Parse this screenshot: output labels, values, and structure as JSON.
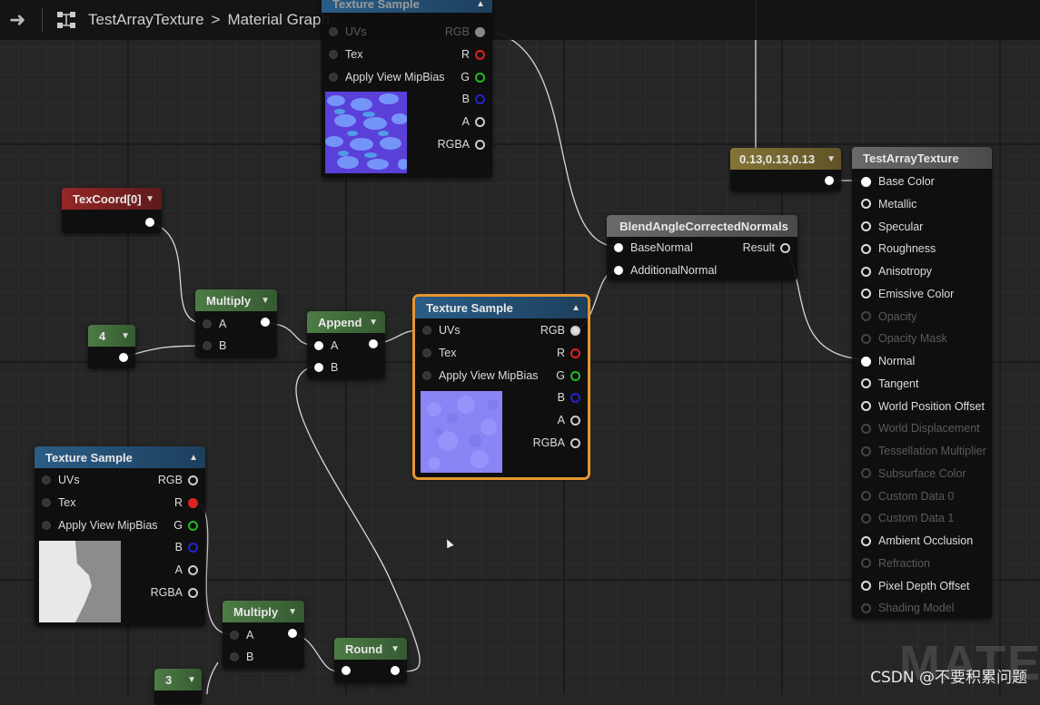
{
  "topbar": {
    "asset_name": "TestArrayTexture",
    "separator": ">",
    "graph_name": "Material Graph"
  },
  "nodes": {
    "tex_sample_top": {
      "title": "Texture Sample",
      "inputs": [
        "UVs",
        "Tex",
        "Apply View MipBias"
      ],
      "outputs": [
        "RGB",
        "R",
        "G",
        "B",
        "A",
        "RGBA"
      ]
    },
    "texcoord": {
      "title": "TexCoord[0]"
    },
    "const4": {
      "value": "4"
    },
    "multiply1": {
      "title": "Multiply",
      "inputs": [
        "A",
        "B"
      ]
    },
    "append": {
      "title": "Append",
      "inputs": [
        "A",
        "B"
      ]
    },
    "tex_sample_mid": {
      "title": "Texture Sample",
      "inputs": [
        "UVs",
        "Tex",
        "Apply View MipBias"
      ],
      "outputs": [
        "RGB",
        "R",
        "G",
        "B",
        "A",
        "RGBA"
      ]
    },
    "blend": {
      "title": "BlendAngleCorrectedNormals",
      "inputs": [
        "BaseNormal",
        "AdditionalNormal"
      ],
      "output": "Result"
    },
    "const_vec": {
      "value": "0.13,0.13,0.13"
    },
    "result": {
      "title": "TestArrayTexture",
      "pins": [
        {
          "label": "Base Color",
          "enabled": true
        },
        {
          "label": "Metallic",
          "enabled": true
        },
        {
          "label": "Specular",
          "enabled": true
        },
        {
          "label": "Roughness",
          "enabled": true
        },
        {
          "label": "Anisotropy",
          "enabled": true
        },
        {
          "label": "Emissive Color",
          "enabled": true
        },
        {
          "label": "Opacity",
          "enabled": false
        },
        {
          "label": "Opacity Mask",
          "enabled": false
        },
        {
          "label": "Normal",
          "enabled": true
        },
        {
          "label": "Tangent",
          "enabled": true
        },
        {
          "label": "World Position Offset",
          "enabled": true
        },
        {
          "label": "World Displacement",
          "enabled": false
        },
        {
          "label": "Tessellation Multiplier",
          "enabled": false
        },
        {
          "label": "Subsurface Color",
          "enabled": false
        },
        {
          "label": "Custom Data 0",
          "enabled": false
        },
        {
          "label": "Custom Data 1",
          "enabled": false
        },
        {
          "label": "Ambient Occlusion",
          "enabled": true
        },
        {
          "label": "Refraction",
          "enabled": false
        },
        {
          "label": "Pixel Depth Offset",
          "enabled": true
        },
        {
          "label": "Shading Model",
          "enabled": false
        }
      ]
    },
    "tex_sample_bl": {
      "title": "Texture Sample",
      "inputs": [
        "UVs",
        "Tex",
        "Apply View MipBias"
      ],
      "outputs": [
        "RGB",
        "R",
        "G",
        "B",
        "A",
        "RGBA"
      ]
    },
    "multiply2": {
      "title": "Multiply",
      "inputs": [
        "A",
        "B"
      ]
    },
    "round": {
      "title": "Round"
    },
    "const3": {
      "value": "3"
    }
  },
  "watermark_bg": "MATER",
  "watermark": "CSDN @不要积累问题"
}
